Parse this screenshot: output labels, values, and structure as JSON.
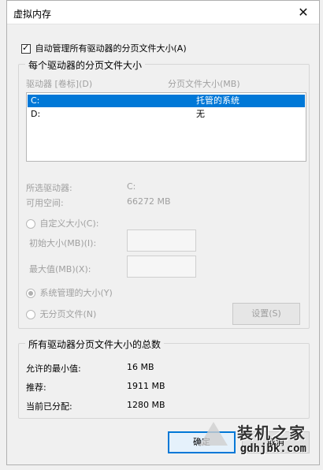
{
  "window": {
    "title": "虚拟内存",
    "close_glyph": "✕"
  },
  "auto_manage": {
    "label": "自动管理所有驱动器的分页文件大小(A)",
    "checked": true
  },
  "per_drive": {
    "group_title": "每个驱动器的分页文件大小",
    "col_drive": "驱动器 [卷标](D)",
    "col_size": "分页文件大小(MB)",
    "rows": [
      {
        "drive": "C:",
        "size": "托管的系统",
        "selected": true
      },
      {
        "drive": "D:",
        "size": "无",
        "selected": false
      }
    ],
    "selected_drive_label": "所选驱动器:",
    "selected_drive_value": "C:",
    "free_space_label": "可用空间:",
    "free_space_value": "66272 MB",
    "custom_size_label": "自定义大小(C):",
    "initial_size_label": "初始大小(MB)(I):",
    "max_size_label": "最大值(MB)(X):",
    "system_managed_label": "系统管理的大小(Y)",
    "no_paging_label": "无分页文件(N)",
    "set_button": "设置(S)",
    "radio_selected": "system_managed"
  },
  "totals": {
    "group_title": "所有驱动器分页文件大小的总数",
    "min_label": "允许的最小值:",
    "min_value": "16 MB",
    "recommended_label": "推荐:",
    "recommended_value": "1911 MB",
    "current_label": "当前已分配:",
    "current_value": "1280 MB"
  },
  "buttons": {
    "ok": "确定",
    "cancel": "取消"
  },
  "watermark": {
    "text": "装机之家",
    "url": "gdhjbk.com"
  },
  "colors": {
    "selection": "#0078d7",
    "disabled_text": "#a0a0a0",
    "primary_border": "#0078d7"
  }
}
